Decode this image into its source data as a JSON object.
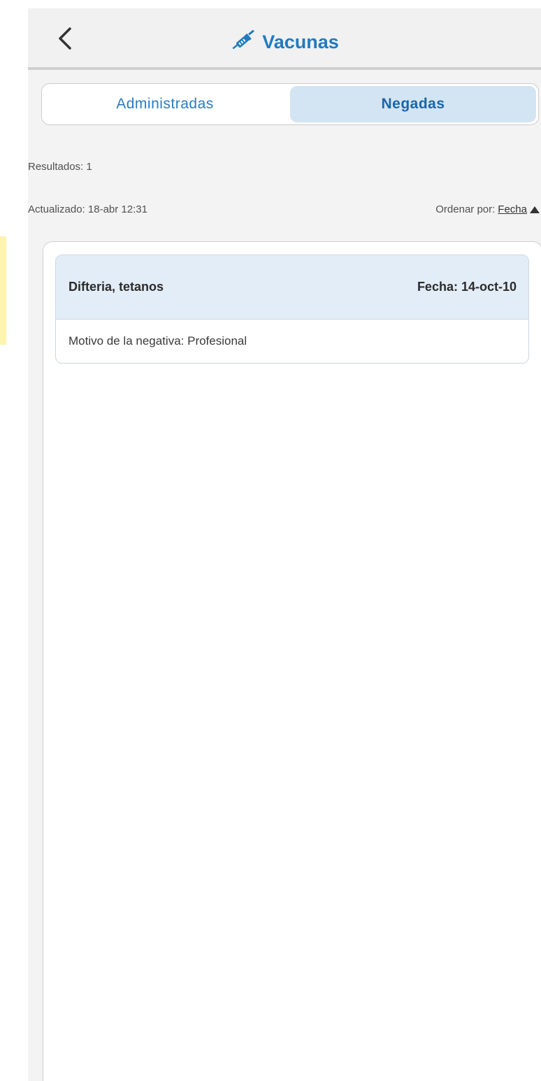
{
  "header": {
    "title": "Vacunas",
    "back_icon": "chevron-left-icon",
    "title_icon": "syringe-icon",
    "accent_color": "#1f7bc1"
  },
  "tabs": [
    {
      "label": "Administradas",
      "active": false
    },
    {
      "label": "Negadas",
      "active": true
    }
  ],
  "summary": {
    "results": "Resultados: 1",
    "updated": "Actualizado: 18-abr 12:31",
    "sort_prefix": "Ordenar por:",
    "sort_field": "Fecha",
    "sort_direction_icon": "triangle-up-icon"
  },
  "records": [
    {
      "vaccine": "Difteria, tetanos",
      "date": "Fecha: 14-oct-10",
      "reason": "Motivo de la negativa: Profesional"
    }
  ]
}
